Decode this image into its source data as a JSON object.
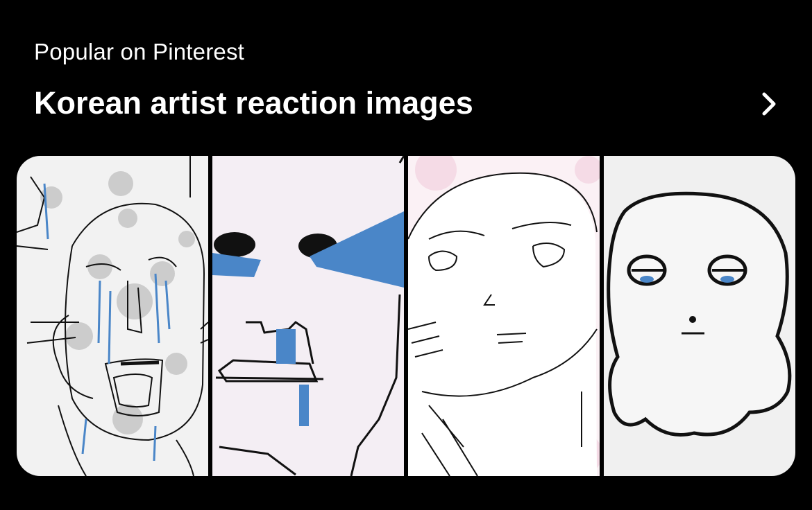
{
  "section": {
    "eyebrow": "Popular on Pinterest",
    "title": "Korean artist reaction images"
  },
  "icons": {
    "more": "chevron-right-icon"
  },
  "gallery": {
    "images": [
      {
        "name": "crying-screaming-face-sketch",
        "background": "#f2f2f2"
      },
      {
        "name": "crying-pixel-face-sketch",
        "background": "#f4eef4"
      },
      {
        "name": "anime-face-sketch",
        "background": "#fbf1f5"
      },
      {
        "name": "blob-character-sketch",
        "background": "#f0f0f0"
      }
    ]
  },
  "colors": {
    "background": "#000000",
    "text": "#ffffff",
    "tear_blue": "#4a86c8"
  }
}
